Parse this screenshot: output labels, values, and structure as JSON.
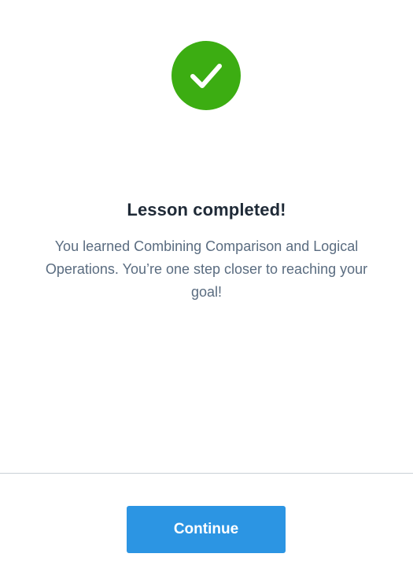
{
  "success": {
    "icon": "checkmark-icon",
    "color": "#3cad12"
  },
  "lesson": {
    "title": "Lesson completed!",
    "message": "You learned Combining Comparison and Logical Operations. You’re one step closer to reaching your goal!"
  },
  "footer": {
    "continue_label": "Continue",
    "button_color": "#2c95e3"
  }
}
